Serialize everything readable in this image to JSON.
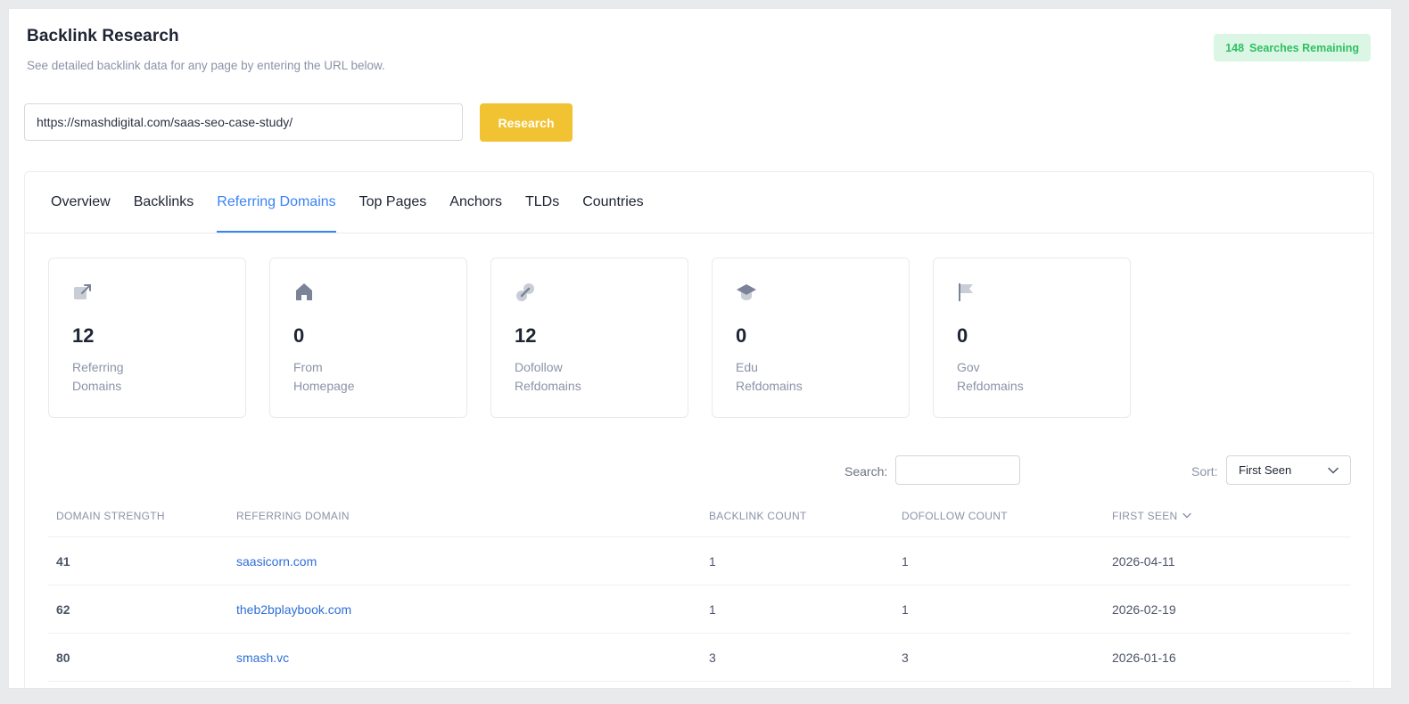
{
  "header": {
    "title": "Backlink Research",
    "subtitle": "See detailed backlink data for any page by entering the URL below."
  },
  "quota": {
    "count": "148",
    "label": "Searches Remaining"
  },
  "search_form": {
    "url_value": "https://smashdigital.com/saas-seo-case-study/",
    "button_label": "Research"
  },
  "tabs": [
    {
      "label": "Overview",
      "active": false
    },
    {
      "label": "Backlinks",
      "active": false
    },
    {
      "label": "Referring Domains",
      "active": true
    },
    {
      "label": "Top Pages",
      "active": false
    },
    {
      "label": "Anchors",
      "active": false
    },
    {
      "label": "TLDs",
      "active": false
    },
    {
      "label": "Countries",
      "active": false
    }
  ],
  "stats": [
    {
      "icon": "external-link-icon",
      "value": "12",
      "label": "Referring Domains"
    },
    {
      "icon": "home-icon",
      "value": "0",
      "label": "From Homepage"
    },
    {
      "icon": "link-icon",
      "value": "12",
      "label": "Dofollow Refdomains"
    },
    {
      "icon": "graduation-cap-icon",
      "value": "0",
      "label": "Edu Refdomains"
    },
    {
      "icon": "flag-icon",
      "value": "0",
      "label": "Gov Refdomains"
    }
  ],
  "filters": {
    "search_label": "Search:",
    "search_value": "",
    "sort_label": "Sort:",
    "sort_value": "First Seen"
  },
  "table": {
    "columns": [
      "DOMAIN STRENGTH",
      "REFERRING DOMAIN",
      "BACKLINK COUNT",
      "DOFOLLOW COUNT",
      "FIRST SEEN"
    ],
    "rows": [
      {
        "strength": "41",
        "domain": "saasicorn.com",
        "backlinks": "1",
        "dofollow": "1",
        "first_seen": "2026-04-11"
      },
      {
        "strength": "62",
        "domain": "theb2bplaybook.com",
        "backlinks": "1",
        "dofollow": "1",
        "first_seen": "2026-02-19"
      },
      {
        "strength": "80",
        "domain": "smash.vc",
        "backlinks": "3",
        "dofollow": "3",
        "first_seen": "2026-01-16"
      }
    ]
  },
  "colors": {
    "accent": "#3b82f6",
    "button": "#f1c232",
    "quota_bg": "#dcf6e5",
    "quota_text": "#2fbf62",
    "icon": "#7b8398"
  }
}
